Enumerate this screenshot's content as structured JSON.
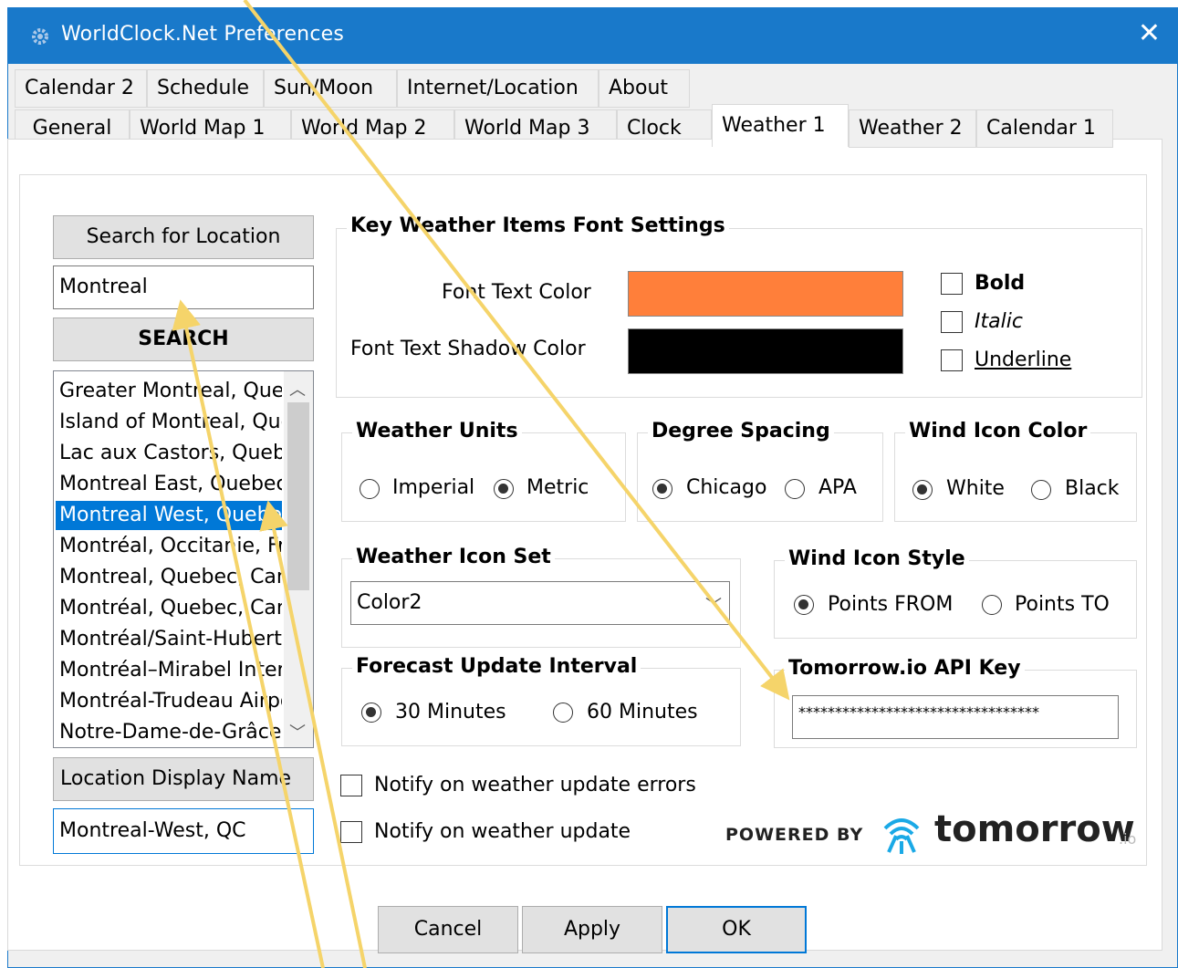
{
  "window": {
    "title": "WorldClock.Net Preferences",
    "close_glyph": "✕"
  },
  "tabs_row1": [
    "Calendar 2",
    "Schedule",
    "Sun/Moon",
    "Internet/Location",
    "About"
  ],
  "tabs_row2": [
    "General",
    "World Map 1",
    "World Map 2",
    "World Map 3",
    "Clock",
    "Weather 1",
    "Weather 2",
    "Calendar 1"
  ],
  "active_tab": "Weather 1",
  "location": {
    "search_label": "Search for Location",
    "search_value": "Montreal",
    "search_button": "SEARCH",
    "results": [
      "Greater Montreal, Quebec",
      "Island of Montreal, Quebec",
      "Lac aux Castors, Quebec",
      "Montreal East, Quebec",
      "Montreal West, Quebec",
      "Montréal, Occitanie, France",
      "Montreal, Quebec, Canada",
      "Montréal, Quebec, Canada",
      "Montréal/Saint-Hubert",
      "Montréal–Mirabel International",
      "Montréal-Trudeau Airport",
      "Notre-Dame-de-Grâce"
    ],
    "selected_result": "Montreal West, Quebec",
    "display_name_label": "Location Display Name",
    "display_name_value": "Montreal-West, QC"
  },
  "font_settings": {
    "title": "Key Weather Items Font Settings",
    "text_color_label": "Font Text Color",
    "text_color": "#ff7f3a",
    "shadow_color_label": "Font Text Shadow Color",
    "shadow_color": "#000000",
    "bold_label": "Bold",
    "italic_label": "Italic",
    "underline_label": "Underline"
  },
  "weather_units": {
    "title": "Weather Units",
    "opt1": "Imperial",
    "opt2": "Metric",
    "selected": "Metric"
  },
  "degree_spacing": {
    "title": "Degree Spacing",
    "opt1": "Chicago",
    "opt2": "APA",
    "selected": "Chicago"
  },
  "wind_icon_color": {
    "title": "Wind Icon Color",
    "opt1": "White",
    "opt2": "Black",
    "selected": "White"
  },
  "weather_icon_set": {
    "title": "Weather Icon Set",
    "value": "Color2"
  },
  "wind_icon_style": {
    "title": "Wind Icon Style",
    "opt1": "Points FROM",
    "opt2": "Points TO",
    "selected": "Points FROM"
  },
  "forecast_interval": {
    "title": "Forecast Update Interval",
    "opt1": "30 Minutes",
    "opt2": "60 Minutes",
    "selected": "30 Minutes"
  },
  "api_key": {
    "title": "Tomorrow.io API Key",
    "value": "*********************************"
  },
  "notify_errors_label": "Notify on weather update errors",
  "notify_update_label": "Notify on weather update",
  "powered": {
    "prefix": "POWERED BY",
    "brand": "tomorrow",
    "suffix": ".io"
  },
  "buttons": {
    "cancel": "Cancel",
    "apply": "Apply",
    "ok": "OK"
  },
  "colors": {
    "titlebar": "#1979ca",
    "selection": "#0078d7",
    "annotation_arrow": "#f5d46a"
  }
}
